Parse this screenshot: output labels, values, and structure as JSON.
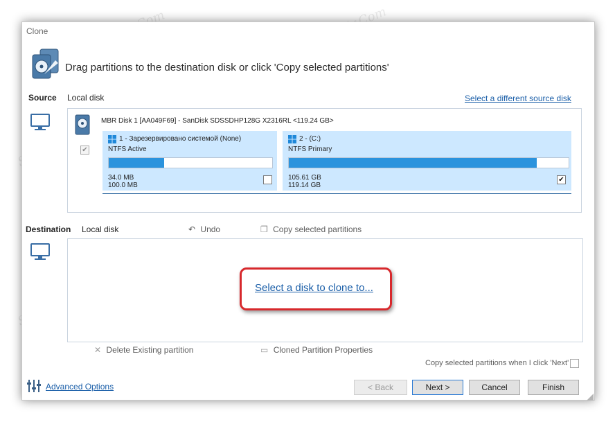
{
  "window": {
    "title": "Clone"
  },
  "header": {
    "instruction": "Drag partitions to the destination disk or click 'Copy selected partitions'"
  },
  "source": {
    "label": "Source",
    "disk_type": "Local disk",
    "change_link": "Select a different source disk",
    "disk_info": "MBR Disk 1 [AA049F69] - SanDisk SDSSDHP128G X2316RL  <119.24 GB>",
    "partitions": [
      {
        "name": "1 - Зарезервировано системой (None)",
        "fs": "NTFS Active",
        "used": "34.0 MB",
        "total": "100.0 MB",
        "fill": 0.34,
        "checked": false,
        "check_glyph": ""
      },
      {
        "name": "2 - (C:)",
        "fs": "NTFS Primary",
        "used": "105.61 GB",
        "total": "119.14 GB",
        "fill": 0.886,
        "checked": true,
        "check_glyph": "✔"
      }
    ]
  },
  "destination": {
    "label": "Destination",
    "disk_type": "Local disk",
    "undo": "Undo",
    "copy_selected": "Copy selected partitions",
    "select_link": "Select a disk to clone to...",
    "delete_existing": "Delete Existing partition",
    "cloned_props": "Cloned Partition Properties",
    "copy_when_next": "Copy selected partitions when I click 'Next'"
  },
  "footer": {
    "advanced": "Advanced Options",
    "back": "< Back",
    "next": "Next >",
    "cancel": "Cancel",
    "finish": "Finish"
  },
  "watermark": "Soringpcrepair.Com",
  "colors": {
    "accent": "#2b93dd",
    "partition_bg": "#cde8ff",
    "link": "#1a5ea8",
    "highlight_frame": "#d7282c"
  }
}
